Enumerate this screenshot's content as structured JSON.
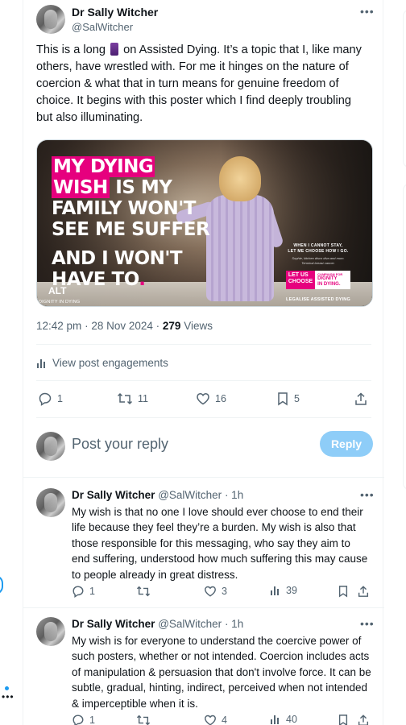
{
  "post": {
    "author_name": "Dr Sally Witcher",
    "author_handle": "@SalWitcher",
    "text_before_emoji": "This is a long ",
    "text_after_emoji": " on Assisted Dying. It’s a topic that I, like many others, have wrestled with. For me it hinges on the nature of coercion & what that in turn means for genuine freedom of choice. It begins with this poster which I find deeply troubling but also illuminating.",
    "time": "12:42 pm",
    "date": "28 Nov 2024",
    "views_count": "279",
    "views_label": "Views",
    "engagements_label": "View post engagements",
    "stats": {
      "replies": "1",
      "reposts": "11",
      "likes": "16",
      "bookmarks": "5"
    }
  },
  "poster": {
    "line1": "MY DYING",
    "line2a": "WISH",
    "line2b": " IS MY",
    "line3": "FAMILY WON'T",
    "line4": "SEE ME SUFFER",
    "line5": "AND I WON'T",
    "line6": "HAVE TO",
    "line6_dot": ".",
    "right_caption_1": "WHEN I CANNOT STAY,",
    "right_caption_2": "LET ME CHOOSE HOW I GO.",
    "right_sub_1": "Sophie, kitchen disco diva and mum.",
    "right_sub_2": "Terminal breast cancer.",
    "logo_let": "LET US",
    "logo_choose": "CHOOSE",
    "logo_campaign": "CAMPAIGN FOR",
    "logo_dignity": "DIGNITY",
    "logo_in_dying": "IN DYING.",
    "legalise": "LEGALISE ASSISTED DYING",
    "alt_badge": "ALT",
    "watermark": "DIGNITY IN DYING"
  },
  "reply_box": {
    "placeholder": "Post your reply",
    "button": "Reply"
  },
  "replies": [
    {
      "author_name": "Dr Sally Witcher",
      "author_handle": "@SalWitcher",
      "time": "· 1h",
      "text": "My wish is that no one I love should ever choose to end their life because they feel they’re a burden. My wish is also that those responsible for this messaging, who say they aim to end suffering, understood how much suffering this may cause to people already in great distress.",
      "stats": {
        "replies": "1",
        "reposts": "",
        "likes": "3",
        "views": "39"
      }
    },
    {
      "author_name": "Dr Sally Witcher",
      "author_handle": "@SalWitcher",
      "time": "· 1h",
      "text": "My wish is for everyone to understand the coercive power of such posters, whether or not intended. Coercion includes acts of manipulation & persuasion that don't involve force. It can be subtle, gradual, hinting, indirect, perceived when not intended & imperceptible when it is.",
      "stats": {
        "replies": "1",
        "reposts": "",
        "likes": "4",
        "views": "40"
      }
    }
  ],
  "icons": {
    "more": "more-icon",
    "reply": "reply-icon",
    "repost": "repost-icon",
    "like": "like-icon",
    "bookmark": "bookmark-icon",
    "share": "share-icon",
    "analytics": "analytics-icon"
  },
  "colors": {
    "accent": "#1d9bf0",
    "reply_button": "#8ecdf8",
    "poster_pink": "#e6007e",
    "secondary_text": "#536471"
  }
}
